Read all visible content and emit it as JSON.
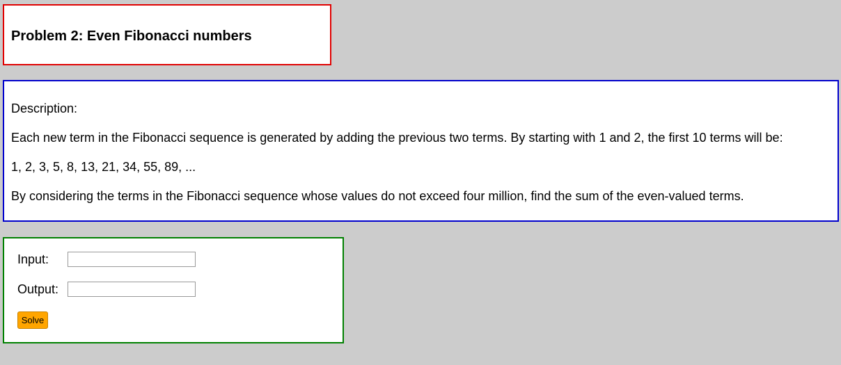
{
  "problem": {
    "title": "Problem 2: Even Fibonacci numbers"
  },
  "description": {
    "heading": "Description:",
    "paragraphs": [
      "Each new term in the Fibonacci sequence is generated by adding the previous two terms. By starting with 1 and 2, the first 10 terms will be:",
      "1, 2, 3, 5, 8, 13, 21, 34, 55, 89, ...",
      "By considering the terms in the Fibonacci sequence whose values do not exceed four million, find the sum of the even-valued terms."
    ]
  },
  "io": {
    "input_label": "Input:",
    "input_value": "",
    "output_label": "Output:",
    "output_value": "",
    "solve_label": "Solve"
  },
  "colors": {
    "background": "#cccccc",
    "title_border": "#e00000",
    "description_border": "#0000cc",
    "io_border": "#008000",
    "solve_button": "#ffa500"
  }
}
